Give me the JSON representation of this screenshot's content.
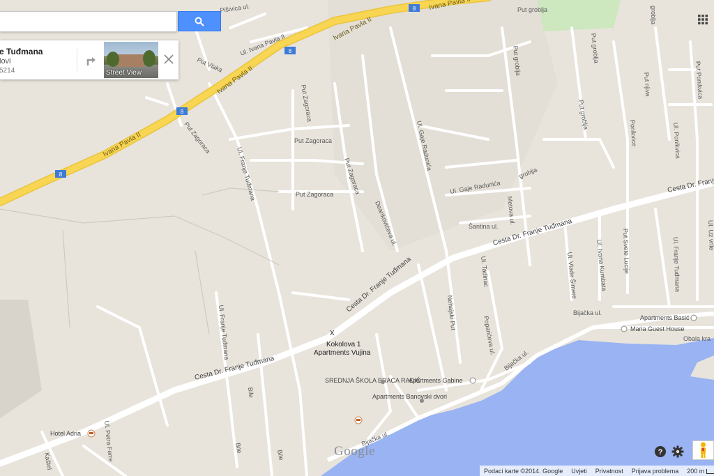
{
  "search": {
    "value": "",
    "placeholder": ""
  },
  "place_card": {
    "title": "e Tuđmana",
    "subtitle": "lovi",
    "number": "5214",
    "street_view_label": "Street View"
  },
  "marker": {
    "symbol": "X",
    "line1": "Kokolova 1",
    "line2": "Apartments Vujina"
  },
  "roads": {
    "highway": "Ivana Pavla II",
    "highway_shield": "8",
    "main": "Cesta Dr. Franje Tuđmana",
    "pisivica": "Pišivica ul.",
    "ivana_pavla": "Ul. Ivana Pavla II",
    "put_vlaka": "Put Vlaka",
    "put_zagoraca": "Put Zagoraca",
    "franje_tudmana": "Ul. Franje Tuđmana",
    "deankoviceva": "Deankovićeva ul.",
    "gaje_radunica": "Ul. Gaje Radunića",
    "put_groblja": "Put groblja",
    "groblja": "groblja",
    "put_njiva": "Put njiva",
    "put_ponikvica": "Put Ponikvica",
    "ponikvice": "Ponikvice",
    "ul_ponikvica": "Ul. Ponikvica",
    "metova": "Metova ul.",
    "santina": "Šantina ul.",
    "tadinac": "Ul. Tadinac",
    "nehajski": "Nehajski Put",
    "poparićeva": "Poparićeva ul.",
    "bijacka": "Bijačka ul.",
    "vlade_simere": "Ul. Vlade Šimere",
    "ivana_kumbata": "Ul. Ivana Kumbata",
    "put_svete_lucije": "Put Svete Lucije",
    "ul_franje": "Ul. Franje Tuđmana",
    "obala": "Obala kra",
    "bile": "Bile",
    "petra_ferre": "Ul. Petra Ferre",
    "kastel": "Kaštel",
    "uz_vrile": "Ul. Uz vrile"
  },
  "pois": [
    {
      "name": "Hotel Adria"
    },
    {
      "name": "SREDNJA ŠKOLA BRACA RADIĆ"
    },
    {
      "name": "Apartments Gabine"
    },
    {
      "name": "Apartments Banovski dvori"
    },
    {
      "name": "Apartments Basić"
    },
    {
      "name": "Maria Guest House"
    }
  ],
  "footer": {
    "map_data": "Podaci karte ©2014. Google",
    "terms": "Uvjeti",
    "privacy": "Privatnost",
    "report": "Prijava problema",
    "scale": "200 m"
  },
  "logo": "Google",
  "colors": {
    "land": "#e8e4dc",
    "road": "#ffffff",
    "highway": "#f8d552",
    "water": "#99b3f3",
    "park": "#cde7be",
    "search_button": "#4d90fe"
  },
  "icons": [
    "search-icon",
    "directions-icon",
    "close-icon",
    "apps-grid-icon",
    "help-icon",
    "gear-icon",
    "pegman-icon",
    "hotel-icon"
  ]
}
